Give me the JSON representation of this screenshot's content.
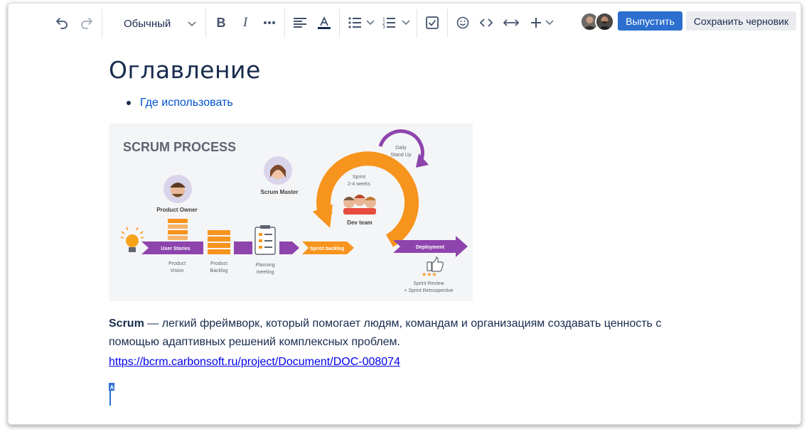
{
  "toolbar": {
    "text_style": "Обычный",
    "publish_label": "Выпустить",
    "draft_label": "Сохранить черновик"
  },
  "doc": {
    "title": "Оглавление",
    "toc": [
      "Где использовать"
    ],
    "paragraph_bold": "Scrum",
    "paragraph_rest": " — легкий фреймворк, который помогает людям, командам и организациям создавать ценность с помощью адаптивных решений комплексных проблем.",
    "link": "https://bcrm.carbonsoft.ru/project/Document/DOC-008074"
  },
  "image": {
    "title": "SCRUM PROCESS",
    "product_owner": "Product Owner",
    "scrum_master": "Scrum Master",
    "daily_line1": "Daily",
    "daily_line2": "Stand Up",
    "sprint_line1": "Sprint",
    "sprint_line2": "2-4 weeks",
    "dev_team": "Dev team",
    "user_stories": "User Stories",
    "sprint_backlog": "Sprint backlog",
    "deployment": "Deployment",
    "product_vision_1": "Product",
    "product_vision_2": "Vision",
    "product_backlog_1": "Product",
    "product_backlog_2": "Backlog",
    "planning_1": "Planning",
    "planning_2": "meeting",
    "review_1": "Sprint Review",
    "review_2": "+ Sprint Retrospective"
  },
  "colors": {
    "accent": "#2c6fce",
    "orange": "#f7941d",
    "purple": "#8e44ad"
  }
}
